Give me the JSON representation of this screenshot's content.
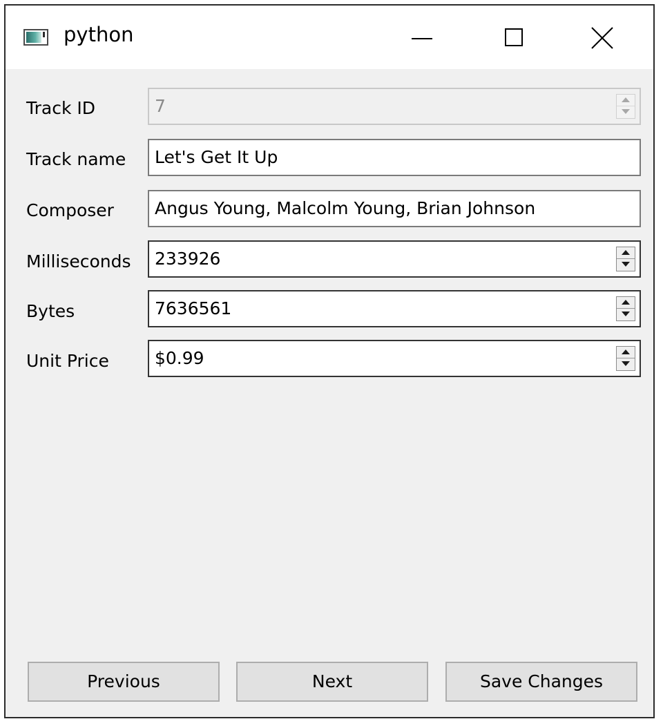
{
  "window": {
    "title": "python",
    "title_icon": "python-app-icon",
    "controls": {
      "minimize_icon": "minimize-icon",
      "maximize_icon": "maximize-icon",
      "close_icon": "close-icon"
    }
  },
  "form": {
    "track_id": {
      "label": "Track ID",
      "value": "7",
      "enabled": false
    },
    "track_name": {
      "label": "Track name",
      "value": "Let's Get It Up"
    },
    "composer": {
      "label": "Composer",
      "value": "Angus Young, Malcolm Young, Brian Johnson"
    },
    "milliseconds": {
      "label": "Milliseconds",
      "value": "233926"
    },
    "bytes": {
      "label": "Bytes",
      "value": "7636561"
    },
    "unit_price": {
      "label": "Unit Price",
      "value": "$0.99"
    }
  },
  "buttons": {
    "previous": "Previous",
    "next": "Next",
    "save": "Save Changes"
  },
  "colors": {
    "window_bg": "#f0f0f0",
    "titlebar_bg": "#ffffff",
    "button_bg": "#e1e1e1",
    "disabled_text": "#8a8a8a"
  }
}
